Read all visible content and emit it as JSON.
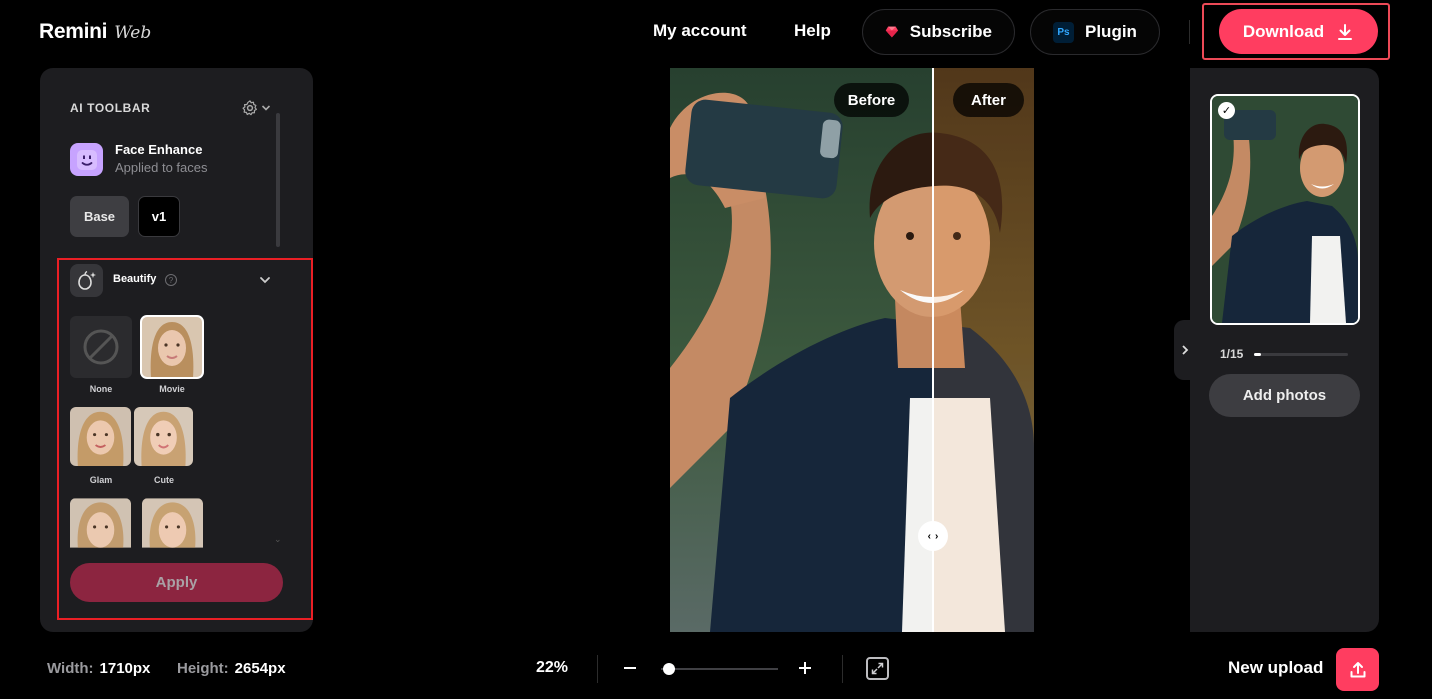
{
  "header": {
    "logo_main": "Remini",
    "logo_sub": "Web",
    "nav": {
      "my_account": "My account",
      "help": "Help"
    },
    "subscribe_label": "Subscribe",
    "plugin_label": "Plugin",
    "plugin_badge": "Ps",
    "download_label": "Download",
    "accent_color": "#ff3d60"
  },
  "toolbar": {
    "title": "AI TOOLBAR",
    "face_enhance": {
      "title": "Face Enhance",
      "subtitle": "Applied to faces"
    },
    "versions": [
      "Base",
      "v1"
    ],
    "beautify": {
      "title": "Beautify",
      "help_glyph": "?",
      "presets": [
        {
          "label": "None",
          "icon": "none-icon"
        },
        {
          "label": "Movie",
          "selected": true
        },
        {
          "label": "Glam"
        },
        {
          "label": "Cute"
        }
      ],
      "apply_label": "Apply"
    }
  },
  "canvas": {
    "before_label": "Before",
    "after_label": "After",
    "split_fraction": 0.72
  },
  "gallery": {
    "counter": "1/15",
    "progress_fraction": 0.067,
    "add_photos_label": "Add photos"
  },
  "footer": {
    "width_label": "Width:",
    "width_value": "1710px",
    "height_label": "Height:",
    "height_value": "2654px",
    "zoom": "22%",
    "new_upload_label": "New upload"
  }
}
